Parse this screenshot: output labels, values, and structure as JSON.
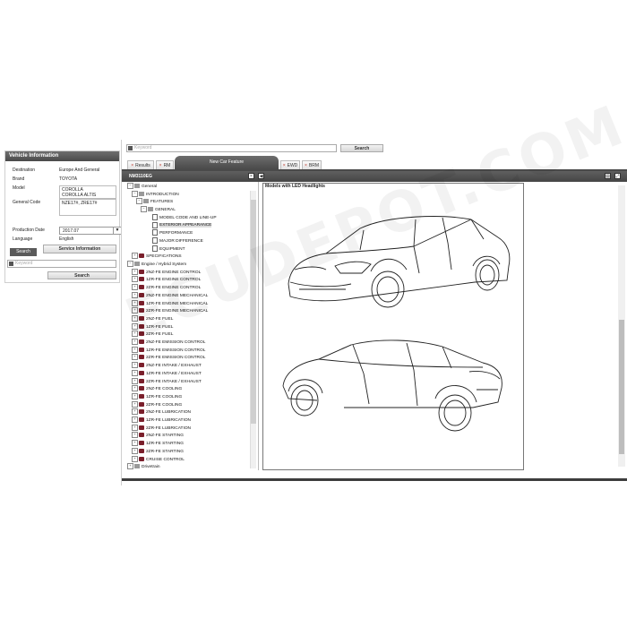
{
  "vehicle_info": {
    "title": "Vehicle Information",
    "rows": [
      {
        "label": "Destination",
        "value": "Europe And General"
      },
      {
        "label": "Brand",
        "value": "TOYOTA"
      },
      {
        "label": "Model",
        "value": "COROLLA"
      },
      {
        "label": "General Code",
        "value": "NZE17#, ZRE17#"
      },
      {
        "label": "Production Date",
        "value": "2017.07"
      },
      {
        "label": "Language",
        "value": "English"
      }
    ],
    "model_line2": "COROLLA ALTIS",
    "search_tab": "Search",
    "service_tab": "Service Information",
    "keyword_placeholder": "Keyword",
    "search_button": "Search"
  },
  "top_search": {
    "placeholder": "Keyword",
    "button": "Search"
  },
  "tabs": [
    {
      "label": "Results",
      "closable": true
    },
    {
      "label": "RM",
      "closable": true
    },
    {
      "label": "New Car Feature",
      "active": true
    },
    {
      "label": "EWD",
      "closable": true
    },
    {
      "label": "BRM",
      "closable": true
    }
  ],
  "tree": {
    "title": "NM3110EG",
    "items": [
      {
        "label": "General",
        "toggle": "−",
        "icon": "book"
      },
      {
        "label": "INTRODUCTION",
        "toggle": "−",
        "icon": "book"
      },
      {
        "label": "FEATURES",
        "toggle": "−",
        "icon": "book"
      },
      {
        "label": "GENERAL",
        "toggle": "−",
        "icon": "book"
      },
      {
        "label": "MODEL CODE AND LINE-UP",
        "toggle": "",
        "icon": "doc"
      },
      {
        "label": "EXTERIOR APPEARANCE",
        "toggle": "",
        "icon": "doc",
        "selected": true
      },
      {
        "label": "PERFORMANCE",
        "toggle": "",
        "icon": "doc"
      },
      {
        "label": "MAJOR DIFFERENCE",
        "toggle": "",
        "icon": "doc"
      },
      {
        "label": "EQUIPMENT",
        "toggle": "",
        "icon": "doc"
      },
      {
        "label": "SPECIFICATIONS",
        "toggle": "+",
        "icon": "folder"
      },
      {
        "label": "Engine / Hybrid System",
        "toggle": "−",
        "icon": "book"
      },
      {
        "label": "2NZ-FE ENGINE CONTROL",
        "toggle": "+",
        "icon": "folder"
      },
      {
        "label": "1ZR-FE ENGINE CONTROL",
        "toggle": "+",
        "icon": "folder"
      },
      {
        "label": "2ZR-FE ENGINE CONTROL",
        "toggle": "+",
        "icon": "folder"
      },
      {
        "label": "2NZ-FE ENGINE MECHANICAL",
        "toggle": "+",
        "icon": "folder"
      },
      {
        "label": "1ZR-FE ENGINE MECHANICAL",
        "toggle": "+",
        "icon": "folder"
      },
      {
        "label": "2ZR-FE ENGINE MECHANICAL",
        "toggle": "+",
        "icon": "folder"
      },
      {
        "label": "2NZ-FE FUEL",
        "toggle": "+",
        "icon": "folder"
      },
      {
        "label": "1ZR-FE FUEL",
        "toggle": "+",
        "icon": "folder"
      },
      {
        "label": "2ZR-FE FUEL",
        "toggle": "+",
        "icon": "folder"
      },
      {
        "label": "2NZ-FE EMISSION CONTROL",
        "toggle": "+",
        "icon": "folder"
      },
      {
        "label": "1ZR-FE EMISSION CONTROL",
        "toggle": "+",
        "icon": "folder"
      },
      {
        "label": "2ZR-FE EMISSION CONTROL",
        "toggle": "+",
        "icon": "folder"
      },
      {
        "label": "2NZ-FE INTAKE / EXHAUST",
        "toggle": "+",
        "icon": "folder"
      },
      {
        "label": "1ZR-FE INTAKE / EXHAUST",
        "toggle": "+",
        "icon": "folder"
      },
      {
        "label": "2ZR-FE INTAKE / EXHAUST",
        "toggle": "+",
        "icon": "folder"
      },
      {
        "label": "2NZ-FE COOLING",
        "toggle": "+",
        "icon": "folder"
      },
      {
        "label": "1ZR-FE COOLING",
        "toggle": "+",
        "icon": "folder"
      },
      {
        "label": "2ZR-FE COOLING",
        "toggle": "+",
        "icon": "folder"
      },
      {
        "label": "2NZ-FE LUBRICATION",
        "toggle": "+",
        "icon": "folder"
      },
      {
        "label": "1ZR-FE LUBRICATION",
        "toggle": "+",
        "icon": "folder"
      },
      {
        "label": "2ZR-FE LUBRICATION",
        "toggle": "+",
        "icon": "folder"
      },
      {
        "label": "2NZ-FE STARTING",
        "toggle": "+",
        "icon": "folder"
      },
      {
        "label": "1ZR-FE STARTING",
        "toggle": "+",
        "icon": "folder"
      },
      {
        "label": "2ZR-FE STARTING",
        "toggle": "+",
        "icon": "folder"
      },
      {
        "label": "CRUISE CONTROL",
        "toggle": "+",
        "icon": "folder"
      },
      {
        "label": "Drivetrain",
        "toggle": "+",
        "icon": "book"
      }
    ]
  },
  "document": {
    "title": "Models with LED Headlights"
  },
  "watermark": "ECUDEPOT.COM"
}
